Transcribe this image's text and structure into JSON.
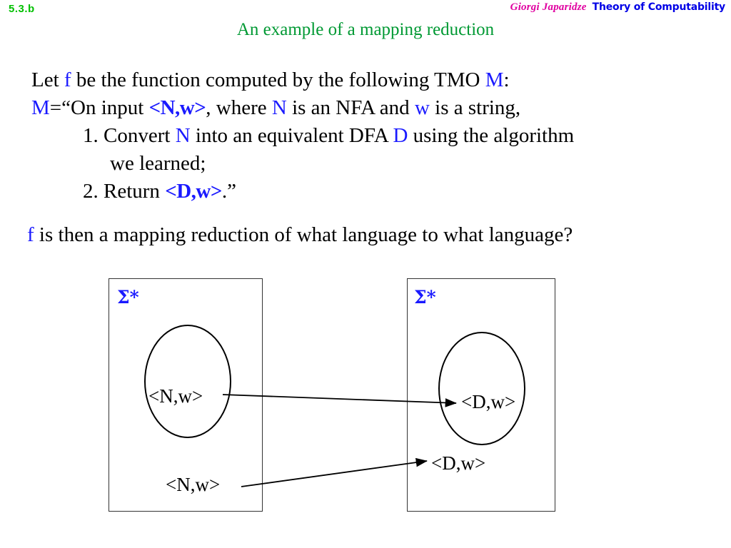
{
  "header": {
    "slide_number": "5.3.b",
    "author": "Giorgi Japaridze",
    "course": "Theory of Computability",
    "slide_number_color": "#00c000",
    "author_color": "#e000a0",
    "course_color": "#0000e6"
  },
  "title": {
    "text": "An example of a mapping reduction",
    "color": "#009933"
  },
  "body": {
    "line1": {
      "part1": "Let ",
      "sym_f": "f",
      "part2": " be the function computed by the following TMO  ",
      "sym_M": "M",
      "part3": ":"
    },
    "line2": {
      "sym_M": "M",
      "part1": "=“On input ",
      "sym_Nw": "<N,w>",
      "part2": ", where ",
      "sym_N": "N",
      "part3": " is an NFA and ",
      "sym_w": "w",
      "part4": " is a string,"
    },
    "item1": {
      "number": "1. ",
      "part1": "Convert ",
      "sym_N": "N",
      "part2": " into an equivalent DFA  ",
      "sym_D": "D",
      "part3": " using the algorithm"
    },
    "item1_cont": "we learned;",
    "item2": {
      "number": "2. ",
      "part1": "Return ",
      "sym_Dw": "<D,w>",
      "part2": ".”"
    },
    "question": {
      "sym_f": "f",
      "text": " is then a mapping reduction of what language to what language?"
    },
    "highlight_color": "#1a1aff"
  },
  "diagram": {
    "left_box": {
      "universe_label": "Σ*",
      "ellipse_element": "<N,w>",
      "outside_element": "<N,w>"
    },
    "right_box": {
      "universe_label": "Σ*",
      "ellipse_element": "<D,w>",
      "outside_element": "<D,w>"
    },
    "universe_label_color": "#1a1aff",
    "line_color": "#000000"
  }
}
